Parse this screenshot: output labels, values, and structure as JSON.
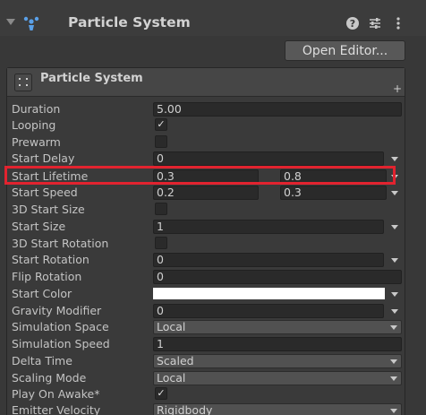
{
  "component": {
    "title": "Particle System",
    "icons": [
      "help-icon",
      "preset-icon",
      "more-options-icon"
    ]
  },
  "open_editor_label": "Open Editor...",
  "module": {
    "title": "Particle System",
    "plus_symbol": "+"
  },
  "properties": {
    "duration": {
      "label": "Duration",
      "value": "5.00"
    },
    "looping": {
      "label": "Looping",
      "checked": true,
      "mark": "✓"
    },
    "prewarm": {
      "label": "Prewarm",
      "checked": false,
      "mark": ""
    },
    "start_delay": {
      "label": "Start Delay",
      "value": "0"
    },
    "start_lifetime": {
      "label": "Start Lifetime",
      "min": "0.3",
      "max": "0.8"
    },
    "start_speed": {
      "label": "Start Speed",
      "min": "0.2",
      "max": "0.3"
    },
    "start_size_3d": {
      "label": "3D Start Size",
      "checked": false,
      "mark": ""
    },
    "start_size": {
      "label": "Start Size",
      "value": "1"
    },
    "start_rotation_3d": {
      "label": "3D Start Rotation",
      "checked": false,
      "mark": ""
    },
    "start_rotation": {
      "label": "Start Rotation",
      "value": "0"
    },
    "flip_rotation": {
      "label": "Flip Rotation",
      "value": "0"
    },
    "start_color": {
      "label": "Start Color",
      "color": "#ffffff"
    },
    "gravity_modifier": {
      "label": "Gravity Modifier",
      "value": "0"
    },
    "simulation_space": {
      "label": "Simulation Space",
      "value": "Local"
    },
    "simulation_speed": {
      "label": "Simulation Speed",
      "value": "1"
    },
    "delta_time": {
      "label": "Delta Time",
      "value": "Scaled"
    },
    "scaling_mode": {
      "label": "Scaling Mode",
      "value": "Local"
    },
    "play_on_awake": {
      "label": "Play On Awake*",
      "checked": true,
      "mark": "✓"
    },
    "emitter_velocity": {
      "label": "Emitter Velocity",
      "value": "Rigidbody"
    }
  },
  "colors": {
    "highlight": "#e2232f",
    "panel_bg": "#383838",
    "field_bg": "#2a2a2a",
    "accent_icon": "#5aa0e8"
  }
}
